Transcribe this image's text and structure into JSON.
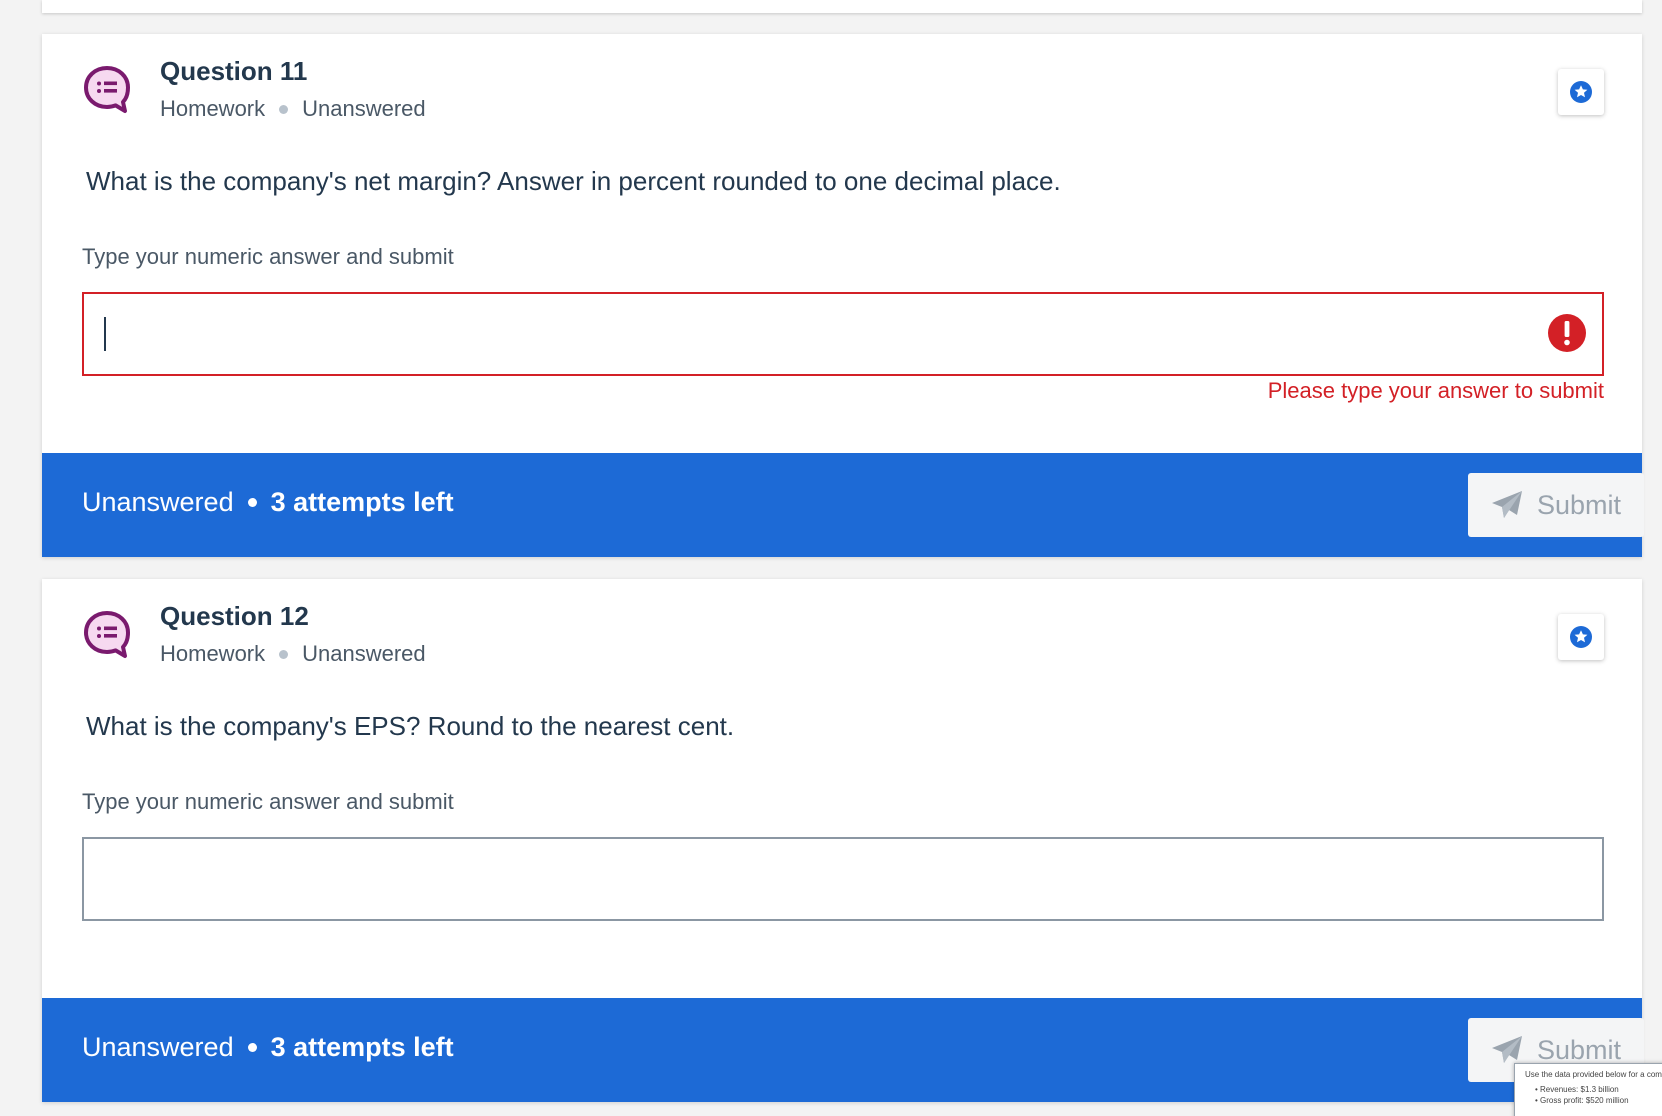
{
  "questions": [
    {
      "title": "Question 11",
      "category": "Homework",
      "status": "Unanswered",
      "prompt": "What is the company's net margin? Answer in percent rounded to one decimal place.",
      "input_label": "Type your numeric answer and submit",
      "input_value": "",
      "error_message": "Please type your answer to submit",
      "footer_status": "Unanswered",
      "attempts_left": "3 attempts left",
      "submit_label": "Submit"
    },
    {
      "title": "Question 12",
      "category": "Homework",
      "status": "Unanswered",
      "prompt": "What is the company's EPS? Round to the nearest cent.",
      "input_label": "Type your numeric answer and submit",
      "input_value": "",
      "footer_status": "Unanswered",
      "attempts_left": "3 attempts left",
      "submit_label": "Submit"
    }
  ],
  "thumbnail": {
    "heading": "Use the data provided below for a com",
    "bullets": [
      "Revenues: $1.3 billion",
      "Gross profit: $520 million"
    ]
  },
  "icons": {
    "question": "discussion-question-icon",
    "favorite": "star-badge-icon",
    "error": "exclamation-circle-icon",
    "submit": "paper-plane-icon"
  },
  "colors": {
    "accent": "#1d6ad6",
    "error": "#d32026",
    "question_icon": "#7a1a6e",
    "question_icon_fill": "#f6d9f0"
  }
}
